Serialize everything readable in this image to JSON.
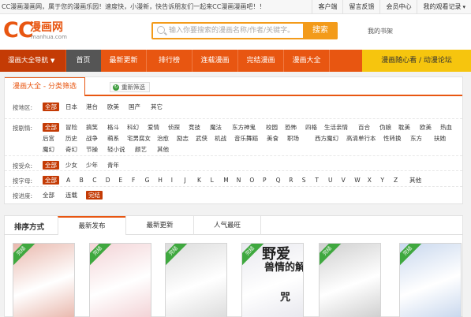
{
  "topbar": {
    "welcome": "CC漫画漫画网，属于您的漫画乐园！速度快，小漫新，快告诉朋友们一起来CC漫画漫画吧！！",
    "links": [
      "客户端",
      "留言反馈",
      "会员中心",
      "我的观看记录"
    ]
  },
  "header": {
    "logo_cc": "CC",
    "logo_cn": "漫画网",
    "logo_domain": "manhua.com",
    "search_placeholder": "输入你要搜索的漫画名称/作者/关键字。",
    "search_button": "搜索",
    "bookshelf": "我的书架"
  },
  "nav": {
    "guide": "漫画大全导航",
    "items": [
      "首页",
      "最新更新",
      "排行榜",
      "连载漫画",
      "完结漫画",
      "漫画大全"
    ],
    "active_index": 0,
    "forum": "漫画随心看 / 动漫论坛"
  },
  "filter": {
    "tab": "漫画大全 - 分类筛选",
    "reset": "重新筛选",
    "region": {
      "label": "按地区:",
      "options": [
        "全部",
        "日本",
        "港台",
        "欧美",
        "国产",
        "其它"
      ],
      "selected": 0
    },
    "genre": {
      "label": "按剧情:",
      "row1": [
        "全部",
        "冒险",
        "搞笑",
        "格斗",
        "科幻",
        "爱情",
        "侦探",
        "竞技",
        "魔法",
        "东方神鬼",
        "校园",
        "恐怖",
        "四格",
        "生活亲情",
        "百合",
        "伪娘",
        "耽美",
        "欧美",
        "热血"
      ],
      "row2": [
        "后宫",
        "历史",
        "战争",
        "萌系",
        "宅男腐女",
        "治愈",
        "励志",
        "武侠",
        "机战",
        "音乐舞蹈",
        "美食",
        "职场",
        "西方魔幻",
        "高清单行本",
        "性转换",
        "东方",
        "扶她"
      ],
      "row3": [
        "魔幻",
        "奇幻",
        "节操",
        "轻小说",
        "颜艺",
        "其他"
      ],
      "selected": 0
    },
    "audience": {
      "label": "按受众:",
      "options": [
        "全部",
        "少女",
        "少年",
        "青年"
      ],
      "selected": 0
    },
    "letter": {
      "label": "按字母:",
      "options": [
        "全部",
        "A",
        "B",
        "C",
        "D",
        "E",
        "F",
        "G",
        "H",
        "I",
        "J",
        "K",
        "L",
        "M",
        "N",
        "O",
        "P",
        "Q",
        "R",
        "S",
        "T",
        "U",
        "V",
        "W",
        "X",
        "Y",
        "Z",
        "其他"
      ],
      "selected": 0
    },
    "progress": {
      "label": "按进度:",
      "options": [
        "全部",
        "连载",
        "完结"
      ],
      "selected": 2
    }
  },
  "sort": {
    "title": "排序方式",
    "tabs": [
      "最新发布",
      "最新更新",
      "人气最旺"
    ],
    "active_index": 0
  },
  "covers": [
    {
      "badge": "完结",
      "color": "#e9b8ad"
    },
    {
      "badge": "完结",
      "color": "#f3d3d6"
    },
    {
      "badge": "完结",
      "color": "#dcdcdc"
    },
    {
      "badge": "完结",
      "color": "#e8e8ee",
      "text": "野 爱\n兽 情\n的 解\n  咒",
      "text_big": "野爱",
      "text_mid": "兽情的解",
      "text_low": "咒"
    },
    {
      "badge": "完结",
      "color": "#cfcfcf"
    },
    {
      "badge": "完结",
      "color": "#c9d8ee"
    }
  ],
  "colors": {
    "brand_orange": "#e85611",
    "nav_dark": "#c43b05",
    "search_orange": "#f39b1a",
    "forum_yellow": "#f6c50e",
    "badge_green": "#3fa83f"
  }
}
